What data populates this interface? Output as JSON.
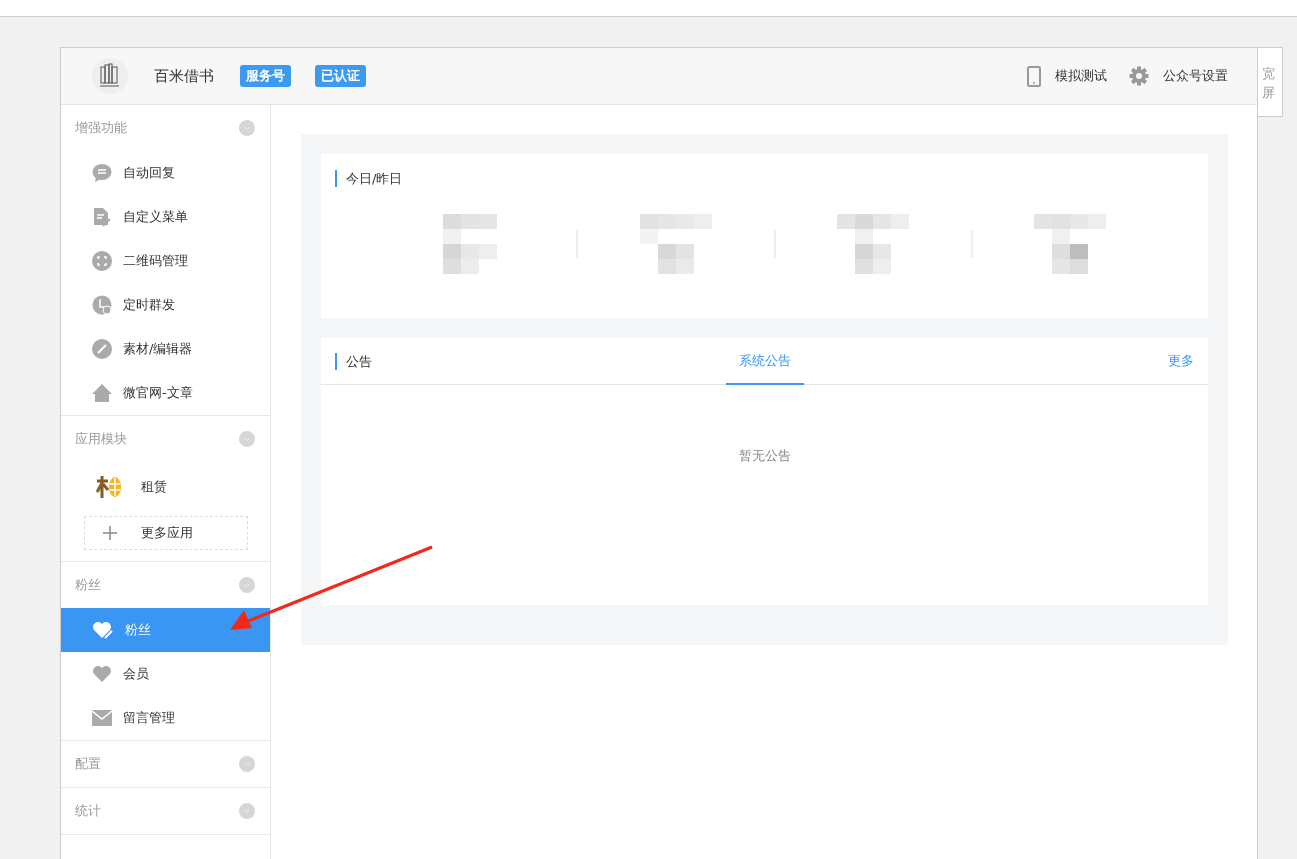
{
  "account": {
    "name": "百米借书",
    "badges": [
      "服务号",
      "已认证"
    ]
  },
  "header_actions": [
    {
      "label": "模拟测试"
    },
    {
      "label": "公众号设置"
    }
  ],
  "wide_screen": {
    "label": "宽屏"
  },
  "sidebar": {
    "sections": [
      {
        "title": "增强功能",
        "items": [
          {
            "label": "自动回复",
            "kind": "link",
            "selected": false
          },
          {
            "label": "自定义菜单",
            "kind": "link",
            "selected": false
          },
          {
            "label": "二维码管理",
            "kind": "link",
            "selected": false
          },
          {
            "label": "定时群发",
            "kind": "link",
            "selected": false
          },
          {
            "label": "素材/编辑器",
            "kind": "link",
            "selected": false
          },
          {
            "label": "微官网-文章",
            "kind": "link",
            "selected": false
          }
        ]
      },
      {
        "title": "应用模块",
        "items": [
          {
            "label": "租赁",
            "kind": "app",
            "selected": false
          },
          {
            "label": "更多应用",
            "kind": "add",
            "selected": false
          }
        ]
      },
      {
        "title": "粉丝",
        "items": [
          {
            "label": "粉丝",
            "kind": "link",
            "selected": true
          },
          {
            "label": "会员",
            "kind": "link",
            "selected": false
          },
          {
            "label": "留言管理",
            "kind": "link",
            "selected": false
          }
        ]
      },
      {
        "title": "配置"
      },
      {
        "title": "统计"
      }
    ]
  },
  "stats_card": {
    "title": "今日/昨日"
  },
  "notice_card": {
    "title": "公告",
    "tabs": [
      {
        "label": "系统公告",
        "selected": true
      }
    ],
    "more": "更多",
    "empty": "暂无公告"
  }
}
